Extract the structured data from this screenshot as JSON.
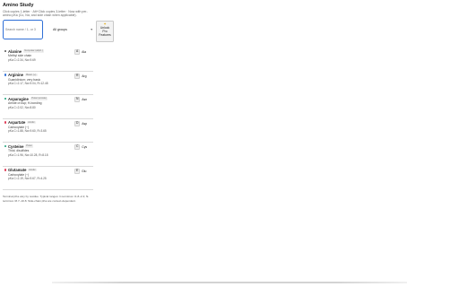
{
  "app": {
    "title": "Amino Study",
    "subtitle": "Click copies 1-letter · Alt+Click copies 3-letter · Now with per-amino pKa (Co, Nα, and side chain when applicable)."
  },
  "search": {
    "placeholder": "Search name / 1- or 3",
    "value": ""
  },
  "filter": {
    "selected": "All groups"
  },
  "unlock_button": {
    "label_line1": "Unlock",
    "label_line2": "Pro",
    "label_line3": "Features"
  },
  "amino_acids": [
    {
      "name": "Alanine",
      "tag": "Nonpolar (aliph.)",
      "desc": "Methyl side chain",
      "pka": "pKa C≈2.34, Nα≈9.69",
      "one": "A",
      "three": "Ala",
      "color": "#555555"
    },
    {
      "name": "Arginine",
      "tag": "Basic (+)",
      "desc": "Guanidinium; very basic",
      "pka": "pKa C≈2.17, Nα≈9.04, R≈12.48",
      "one": "R",
      "three": "Arg",
      "color": "#2f6fd6"
    },
    {
      "name": "Asparagine",
      "tag": "Polar (amide)",
      "desc": "Amide of Asp; H-bonding",
      "pka": "pKa C≈2.02, Nα≈8.80",
      "one": "N",
      "three": "Asn",
      "color": "#1aa27a"
    },
    {
      "name": "Aspartate",
      "tag": "Acidic",
      "desc": "Carboxylate (−)",
      "pka": "pKa C≈1.88, Nα≈9.60, R≈3.65",
      "one": "D",
      "three": "Asp",
      "color": "#e0405a"
    },
    {
      "name": "Cysteine",
      "tag": "Polar",
      "desc": "Thiol; disulfides",
      "pka": "pKa C≈1.96, Nα≈10.28, R≈8.18",
      "one": "C",
      "three": "Cys",
      "color": "#1aa27a"
    },
    {
      "name": "Glutamate",
      "tag": "Acidic",
      "desc": "Carboxylate (−)",
      "pka": "pKa C≈2.19, Nα≈9.67, R≈4.25",
      "one": "E",
      "three": "Glu",
      "color": "#e0405a"
    }
  ],
  "footer": {
    "note": "Terminal pKa vary by residue. Typical ranges: C-terminus ≈1.8–2.4; N-terminus ≈8.7–10.8. Side-chain pKa are context-dependent."
  },
  "icons": {
    "unlock": "lightbulb-icon",
    "dropdown": "chevron-down-icon"
  }
}
